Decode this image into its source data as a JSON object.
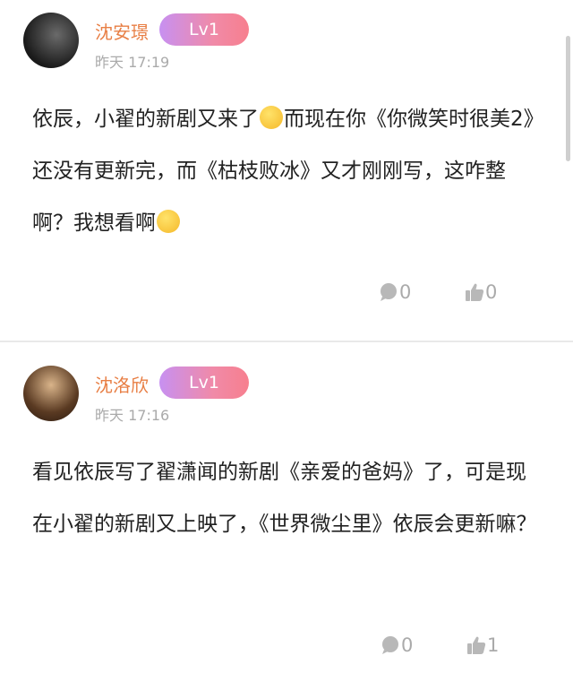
{
  "comments": [
    {
      "username": "沈安璟",
      "level": "Lv1",
      "time": "昨天 17:19",
      "text_part1": "依辰，小翟的新剧又来了",
      "text_part2": "而现在你《你微笑时很美2》还没有更新完，而《枯枝败冰》又才刚刚写，这咋整啊？我想看啊",
      "comments_count": "0",
      "likes_count": "0"
    },
    {
      "username": "沈洛欣",
      "level": "Lv1",
      "time": "昨天 17:16",
      "text": "看见依辰写了翟潇闻的新剧《亲爱的爸妈》了，可是现在小翟的新剧又上映了，《世界微尘里》依辰会更新嘛？",
      "comments_count": "0",
      "likes_count": "1"
    }
  ],
  "icons": {
    "comment": "comment-bubble-icon",
    "like": "thumbs-up-icon"
  },
  "colors": {
    "username": "#e87f45",
    "level_gradient_start": "#c790f1",
    "level_gradient_end": "#f77f8e"
  }
}
